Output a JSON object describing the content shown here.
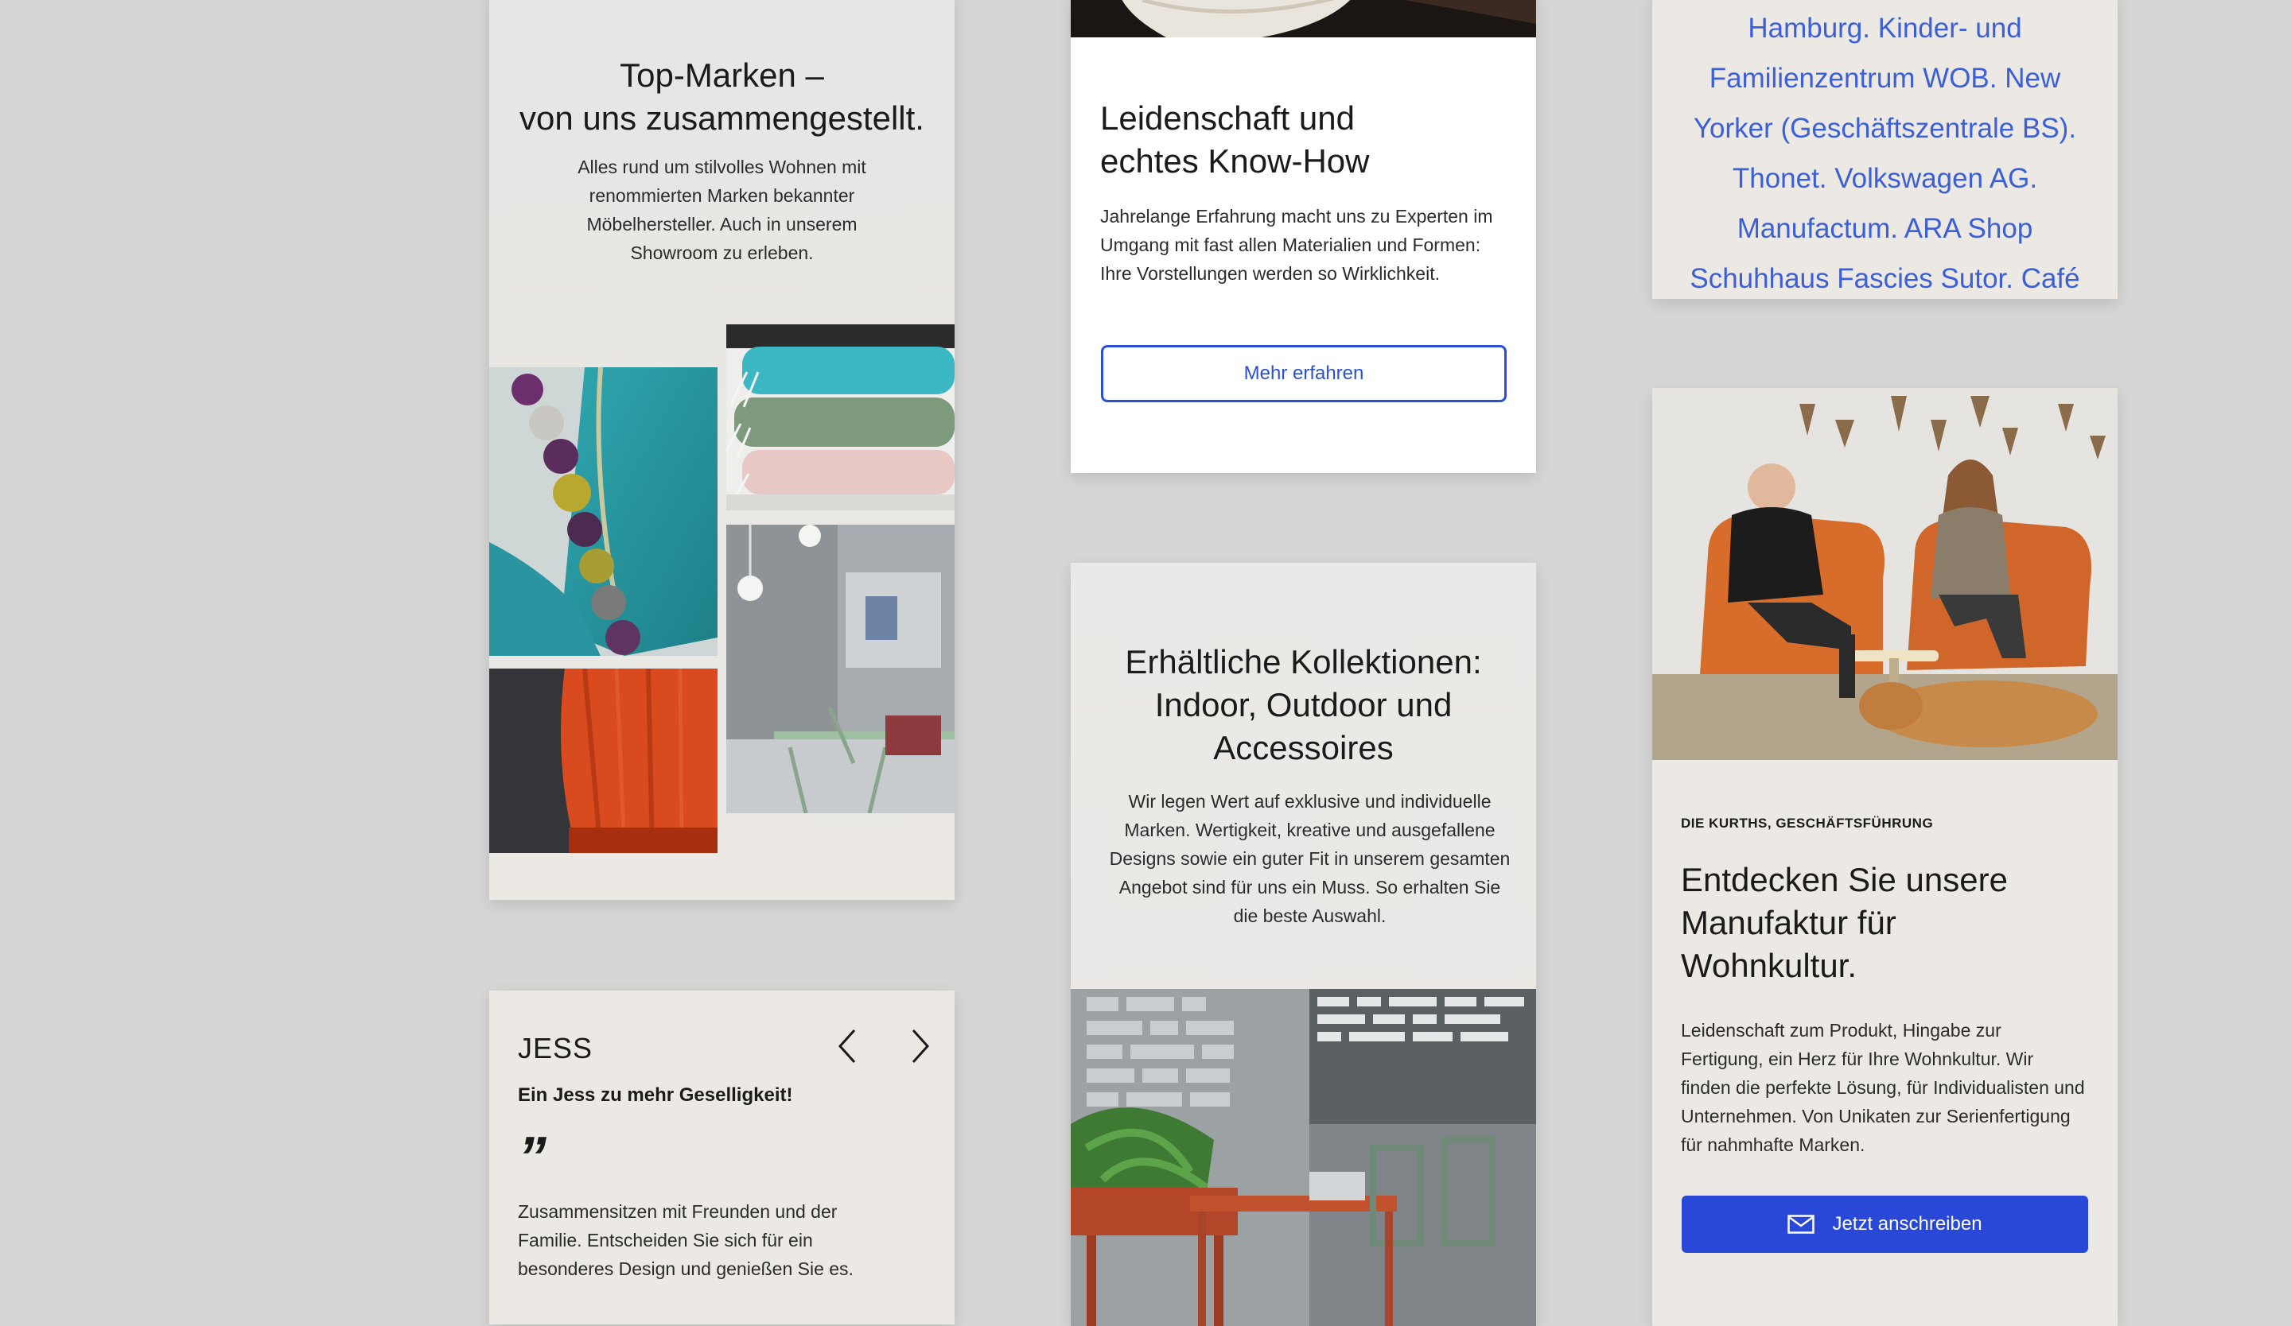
{
  "brands_card": {
    "title_line1": "Top-Marken –",
    "title_line2": "von uns zusammengestellt.",
    "text": "Alles rund um stilvolles Wohnen mit renommierten Marken bekannter Möbelhersteller. Auch in unserem Showroom zu erleben."
  },
  "testimonial_card": {
    "name": "JESS",
    "subtitle": "Ein Jess zu mehr Geselligkeit!",
    "quote_mark": "”",
    "text": "Zusammensitzen mit Freunden und der Familie. Entscheiden Sie sich für ein besonderes Design und genießen Sie es."
  },
  "knowhow_card": {
    "title_line1": "Leidenschaft und",
    "title_line2": "echtes Know-How",
    "text": "Jahrelange Erfahrung macht uns zu Experten im Umgang mit fast allen Materialien und Formen: Ihre Vorstellungen werden so Wirklichkeit.",
    "button_label": "Mehr erfahren"
  },
  "collections_card": {
    "title_line1": "Erhältliche Kollektionen:",
    "title_line2": "Indoor, Outdoor und",
    "title_line3": "Accessoires",
    "text": "Wir legen Wert auf exklusive und individuelle Marken. Wertigkeit, kreative und ausgefallene Designs sowie ein guter Fit in unserem gesamten Angebot sind für uns ein Muss. So erhalten Sie die beste Auswahl."
  },
  "clients_card": {
    "lines": [
      "Hamburg. Kinder- und",
      "Familienzentrum WOB. New",
      "Yorker (Geschäftszentrale BS).",
      "Thonet. Volkswagen AG.",
      "Manufactum. ARA Shop",
      "Schuhhaus Fascies Sutor. Café"
    ]
  },
  "manufaktur_card": {
    "eyebrow": "DIE KURTHS, GESCHÄFTSFÜHRUNG",
    "title_line1": "Entdecken Sie unsere",
    "title_line2": "Manufaktur für",
    "title_line3": "Wohnkultur.",
    "text": "Leidenschaft zum Produkt, Hingabe zur Fertigung, ein Herz für Ihre Wohnkultur. Wir finden die perfekte Lösung, für Individualisten und Unternehmen. Von Unikaten zur Serienfertigung für nahmhafte Marken.",
    "button_label": "Jetzt anschreiben",
    "button_icon": "mail-icon"
  },
  "colors": {
    "accent": "#2a48d8",
    "link": "#3b5fd8",
    "background": "#d6d6d6",
    "card_warm": "#ece8e3",
    "card_white": "#ffffff"
  }
}
